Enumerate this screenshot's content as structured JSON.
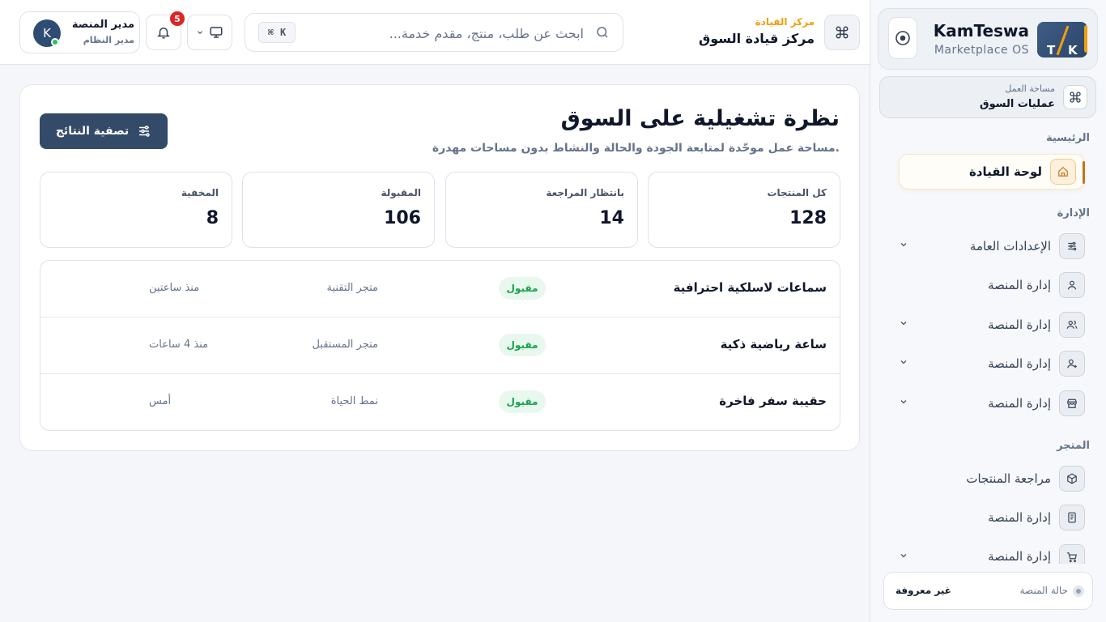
{
  "sidebar": {
    "brand": {
      "name": "KamTeswa",
      "subtitle": "Marketplace OS",
      "logo_letters": [
        "T",
        "K"
      ]
    },
    "workspace": {
      "label": "مساحة العمل",
      "value": "عمليات السوق"
    },
    "sections": {
      "main": "الرئيسية",
      "admin": "الإدارة",
      "store": "المتجر"
    },
    "items": [
      {
        "label": "لوحة القيادة",
        "icon": "home-icon",
        "active": true
      },
      {
        "label": "الإعدادات العامة",
        "icon": "sliders-icon",
        "chevron": true
      },
      {
        "label": "إدارة المنصة",
        "icon": "user-icon"
      },
      {
        "label": "إدارة المنصة",
        "icon": "users-icon",
        "chevron": true
      },
      {
        "label": "إدارة المنصة",
        "icon": "user-plus-icon",
        "chevron": true
      },
      {
        "label": "إدارة المنصة",
        "icon": "store-icon",
        "chevron": true
      },
      {
        "label": "مراجعة المنتجات",
        "icon": "box-icon"
      },
      {
        "label": "إدارة المنصة",
        "icon": "receipt-icon"
      },
      {
        "label": "إدارة المنصة",
        "icon": "cart-icon",
        "chevron": true
      }
    ],
    "status": {
      "label": "حالة المنصة",
      "value": "غير معروفة"
    }
  },
  "topbar": {
    "breadcrumb": "مركز القيادة",
    "title": "مركز قيادة السوق",
    "search": {
      "placeholder": "ابحث عن طلب، منتج، مقدم خدمة...",
      "shortcut_key": "K"
    },
    "notifications_count": "5",
    "user": {
      "name": "مدير المنصة",
      "role": "مدير النظام",
      "initial": "K"
    }
  },
  "main": {
    "title": "نظرة تشغيلية على السوق",
    "subtitle": "مساحة عمل موحّدة لمتابعة الجودة والحالة والنشاط بدون مساحات مهدرة.",
    "filter_label": "تصفية النتائج",
    "stats": [
      {
        "label": "كل المنتجات",
        "value": "128"
      },
      {
        "label": "بانتظار المراجعة",
        "value": "14"
      },
      {
        "label": "المقبولة",
        "value": "106"
      },
      {
        "label": "المخفية",
        "value": "8"
      }
    ],
    "rows": [
      {
        "name": "سماعات لاسلكية احترافية",
        "status": "مقبول",
        "store": "متجر التقنية",
        "time": "منذ ساعتين"
      },
      {
        "name": "ساعة رياضية ذكية",
        "status": "مقبول",
        "store": "متجر المستقبل",
        "time": "منذ 4 ساعات"
      },
      {
        "name": "حقيبة سفر فاخرة",
        "status": "مقبول",
        "store": "نمط الحياة",
        "time": "أمس"
      }
    ]
  },
  "colors": {
    "accent": "#f59e0b",
    "primary": "#344a69",
    "success": "#16a34a",
    "danger": "#dc2626"
  }
}
